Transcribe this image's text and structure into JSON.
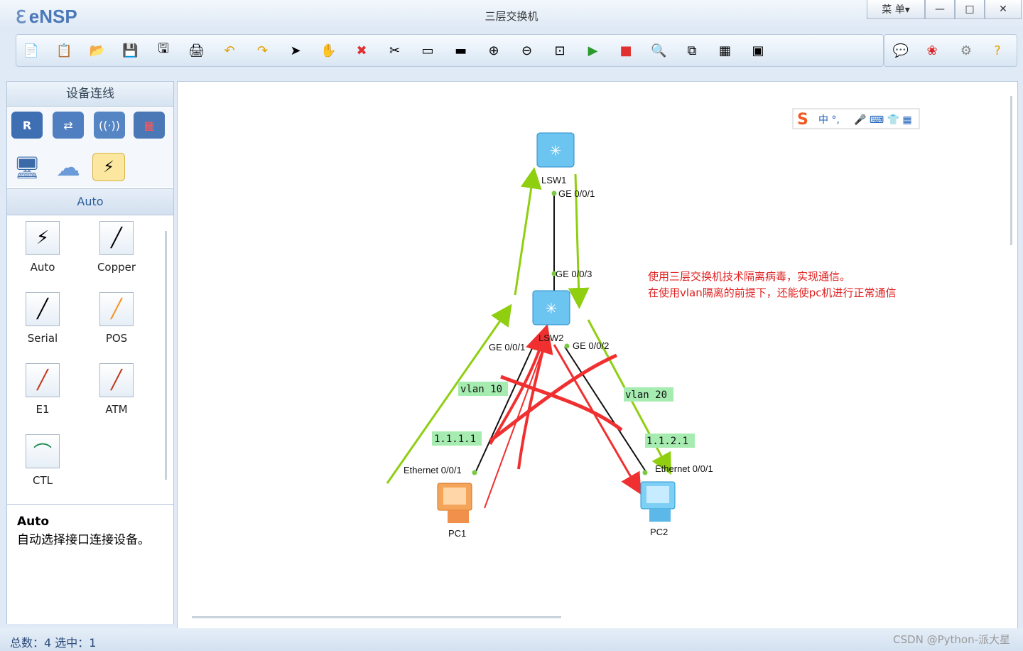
{
  "app": {
    "name": "eNSP",
    "window_title": "三层交换机",
    "menu_label": "菜 单▾"
  },
  "toolbar_icons": [
    "new-topo-icon",
    "new-example-icon",
    "open-icon",
    "save-icon",
    "save-as-icon",
    "print-icon",
    "undo-icon",
    "redo-icon",
    "select-icon",
    "pan-icon",
    "delete-icon",
    "delete-links-icon",
    "text-icon",
    "rectangle-icon",
    "zoom-in-icon",
    "zoom-out-icon",
    "fit-icon",
    "start-icon",
    "stop-icon",
    "capture-icon",
    "topology-icon",
    "grid-icon",
    "console-icon"
  ],
  "right_icons": [
    "chat-icon",
    "huawei-icon",
    "settings-icon",
    "help-icon"
  ],
  "left_panel": {
    "title": "设备连线",
    "category": "Auto",
    "cables": [
      {
        "label": "Auto",
        "color": "#000"
      },
      {
        "label": "Copper",
        "color": "#000"
      },
      {
        "label": "Serial",
        "color": "#000"
      },
      {
        "label": "POS",
        "color": "#f7931e"
      },
      {
        "label": "E1",
        "color": "#c0391a"
      },
      {
        "label": "ATM",
        "color": "#c0391a"
      },
      {
        "label": "CTL",
        "color": "#1a8a50"
      }
    ],
    "desc_title": "Auto",
    "desc_text": "自动选择接口连接设备。"
  },
  "topology": {
    "devices": {
      "lsw1": "LSW1",
      "lsw2": "LSW2",
      "pc1": "PC1",
      "pc2": "PC2"
    },
    "ports": {
      "lsw1_ge": "GE 0/0/1",
      "lsw2_ge3": "GE 0/0/3",
      "lsw2_ge1": "GE 0/0/1",
      "lsw2_ge2": "GE 0/0/2",
      "pc1_eth": "Ethernet 0/0/1",
      "pc2_eth": "Ethernet 0/0/1"
    },
    "tags": {
      "vlan10": "vlan 10",
      "vlan20": "vlan 20",
      "ip1": "1.1.1.1",
      "ip2": "1.1.2.1"
    },
    "note_line1": "使用三层交换机技术隔离病毒，实现通信。",
    "note_line2": "在使用vlan隔离的前提下，还能使pc机进行正常通信",
    "ime": "中 °,"
  },
  "status": {
    "text": "总数：4  选中：1",
    "watermark": "CSDN @Python-派大星"
  }
}
